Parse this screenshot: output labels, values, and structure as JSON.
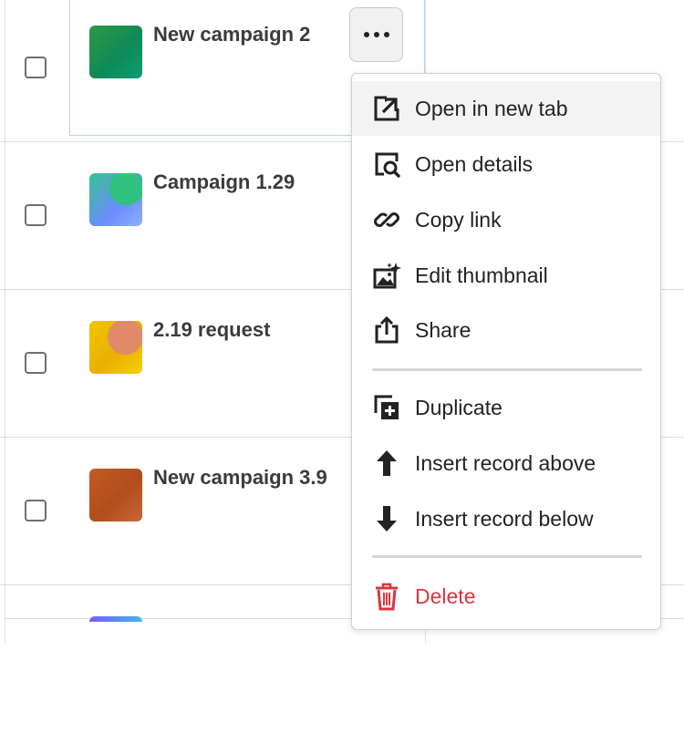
{
  "rows": [
    {
      "name": "New campaign 2",
      "thumb_colors": [
        "#1f8a3f",
        "#0e9e6a"
      ]
    },
    {
      "name": "Campaign 1.29",
      "thumb_colors": [
        "#36c48f",
        "#6a8cff"
      ]
    },
    {
      "name": "2.19 request",
      "thumb_colors": [
        "#f0c000",
        "#e07a6a"
      ]
    },
    {
      "name": "New campaign 3.9",
      "thumb_colors": [
        "#c2541a",
        "#a9431b"
      ]
    }
  ],
  "more_button": {
    "icon": "ellipsis-icon"
  },
  "menu": {
    "items": [
      {
        "label": "Open in new tab",
        "icon": "open-in-new-tab-icon"
      },
      {
        "label": "Open details",
        "icon": "open-details-icon"
      },
      {
        "label": "Copy link",
        "icon": "link-icon"
      },
      {
        "label": "Edit thumbnail",
        "icon": "edit-thumbnail-icon"
      },
      {
        "label": "Share",
        "icon": "share-icon"
      },
      {
        "label": "Duplicate",
        "icon": "duplicate-icon"
      },
      {
        "label": "Insert record above",
        "icon": "arrow-up-icon"
      },
      {
        "label": "Insert record below",
        "icon": "arrow-down-icon"
      },
      {
        "label": "Delete",
        "icon": "trash-icon"
      }
    ]
  },
  "colors": {
    "danger": "#d7373f",
    "selection_border": "#b8d2ee"
  }
}
